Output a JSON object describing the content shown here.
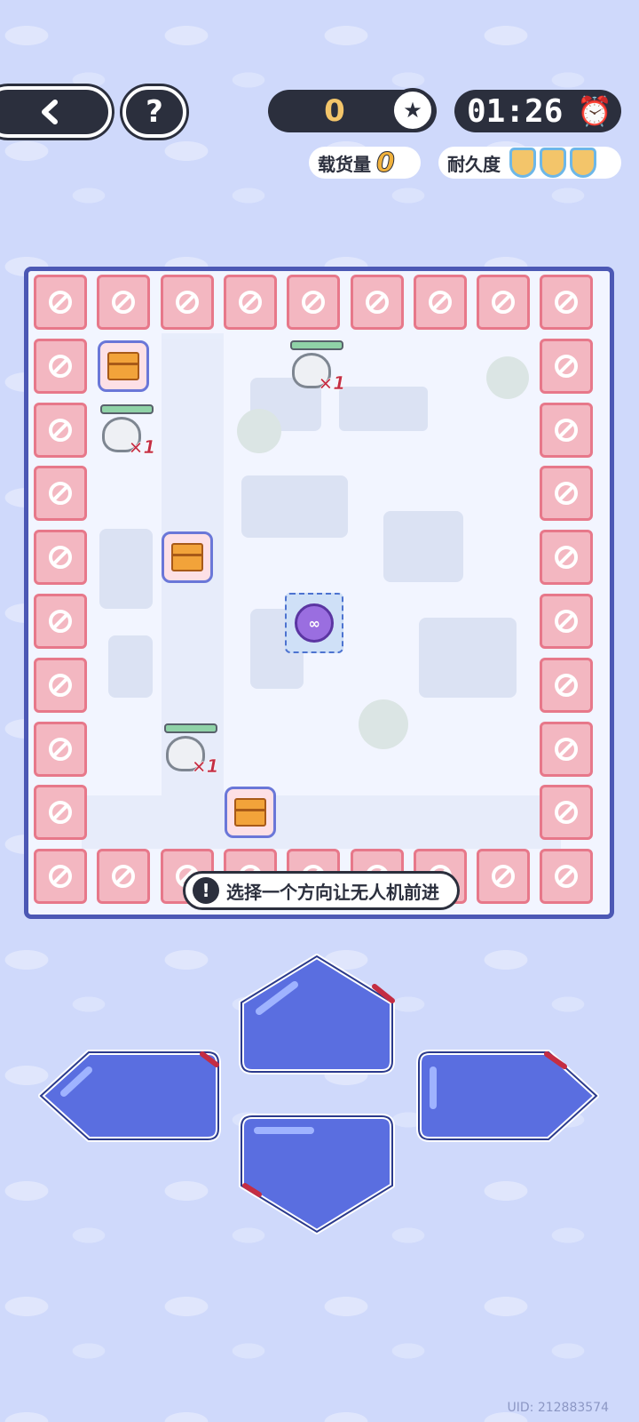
{
  "header": {
    "back_icon": "chevron-left-icon",
    "help_label": "?",
    "score": "0",
    "score_icon": "medal-icon",
    "timer": "01:26",
    "timer_icon": "alarm-clock-icon"
  },
  "stats": {
    "cargo_label": "载货量",
    "cargo_value": "0",
    "durability_label": "耐久度",
    "durability_shields": 3
  },
  "board": {
    "cols": 9,
    "rows": 10,
    "blocked_icon": "no-entry-icon",
    "items": [
      {
        "type": "package",
        "col": 1,
        "row": 1
      },
      {
        "type": "receipt",
        "col": 4,
        "row": 1,
        "mult": "×1"
      },
      {
        "type": "receipt",
        "col": 1,
        "row": 2,
        "mult": "×1"
      },
      {
        "type": "package",
        "col": 2,
        "row": 4
      },
      {
        "type": "receipt",
        "col": 2,
        "row": 7,
        "mult": "×1"
      },
      {
        "type": "package",
        "col": 3,
        "row": 8
      }
    ],
    "drone": {
      "col": 4,
      "row": 5,
      "label": "∞"
    }
  },
  "hint": "选择一个方向让无人机前进",
  "uid": "UID: 212883574",
  "colors": {
    "background": "#cfd9fb",
    "dark": "#2b2f3d",
    "blocked_tile": "#f3b7c1",
    "button_fill": "#5a6ee0"
  }
}
